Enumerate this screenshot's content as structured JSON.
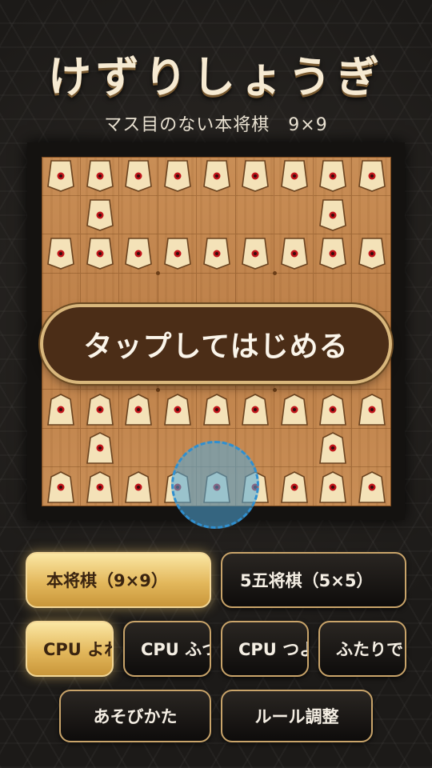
{
  "app": {
    "title": "けずりしょうぎ",
    "subtitle": "マス目のない本将棋　9×9"
  },
  "board": {
    "size": 9,
    "tap_prompt": "タップしてはじめる",
    "pieces": [
      {
        "row": 0,
        "col": 0,
        "side": "gote"
      },
      {
        "row": 0,
        "col": 1,
        "side": "gote"
      },
      {
        "row": 0,
        "col": 2,
        "side": "gote"
      },
      {
        "row": 0,
        "col": 3,
        "side": "gote"
      },
      {
        "row": 0,
        "col": 4,
        "side": "gote"
      },
      {
        "row": 0,
        "col": 5,
        "side": "gote"
      },
      {
        "row": 0,
        "col": 6,
        "side": "gote"
      },
      {
        "row": 0,
        "col": 7,
        "side": "gote"
      },
      {
        "row": 0,
        "col": 8,
        "side": "gote"
      },
      {
        "row": 1,
        "col": 1,
        "side": "gote"
      },
      {
        "row": 1,
        "col": 7,
        "side": "gote"
      },
      {
        "row": 2,
        "col": 0,
        "side": "gote"
      },
      {
        "row": 2,
        "col": 1,
        "side": "gote"
      },
      {
        "row": 2,
        "col": 2,
        "side": "gote"
      },
      {
        "row": 2,
        "col": 3,
        "side": "gote"
      },
      {
        "row": 2,
        "col": 4,
        "side": "gote"
      },
      {
        "row": 2,
        "col": 5,
        "side": "gote"
      },
      {
        "row": 2,
        "col": 6,
        "side": "gote"
      },
      {
        "row": 2,
        "col": 7,
        "side": "gote"
      },
      {
        "row": 2,
        "col": 8,
        "side": "gote"
      },
      {
        "row": 6,
        "col": 0,
        "side": "sente"
      },
      {
        "row": 6,
        "col": 1,
        "side": "sente"
      },
      {
        "row": 6,
        "col": 2,
        "side": "sente"
      },
      {
        "row": 6,
        "col": 3,
        "side": "sente"
      },
      {
        "row": 6,
        "col": 4,
        "side": "sente"
      },
      {
        "row": 6,
        "col": 5,
        "side": "sente"
      },
      {
        "row": 6,
        "col": 6,
        "side": "sente"
      },
      {
        "row": 6,
        "col": 7,
        "side": "sente"
      },
      {
        "row": 6,
        "col": 8,
        "side": "sente"
      },
      {
        "row": 7,
        "col": 1,
        "side": "sente"
      },
      {
        "row": 7,
        "col": 7,
        "side": "sente"
      },
      {
        "row": 8,
        "col": 0,
        "side": "sente"
      },
      {
        "row": 8,
        "col": 1,
        "side": "sente"
      },
      {
        "row": 8,
        "col": 2,
        "side": "sente"
      },
      {
        "row": 8,
        "col": 3,
        "side": "sente"
      },
      {
        "row": 8,
        "col": 4,
        "side": "sente"
      },
      {
        "row": 8,
        "col": 5,
        "side": "sente"
      },
      {
        "row": 8,
        "col": 6,
        "side": "sente"
      },
      {
        "row": 8,
        "col": 7,
        "side": "sente"
      },
      {
        "row": 8,
        "col": 8,
        "side": "sente"
      }
    ]
  },
  "modes": {
    "standard": "本将棋（9×9）",
    "mini": "5五将棋（5×5）"
  },
  "opponents": {
    "cpu_weak": "CPU よわい",
    "cpu_normal": "CPU ふつう",
    "cpu_strong": "CPU つよい",
    "two_players": "ふたりで"
  },
  "footer": {
    "how_to_play": "あそびかた",
    "rule_settings": "ルール調整"
  },
  "colors": {
    "accent_gold": "#e3b85c",
    "board_wood": "#c98e56",
    "piece_mark": "#c0141a"
  }
}
